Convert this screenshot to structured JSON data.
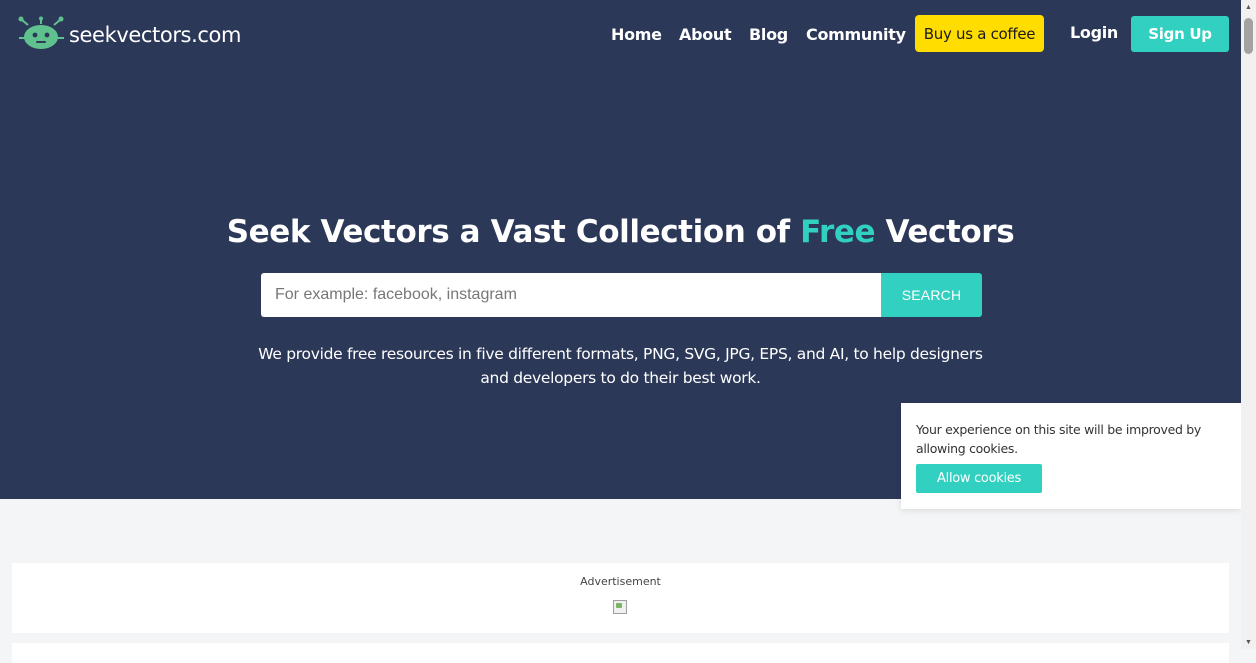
{
  "brand": {
    "logo_text": "seekvectors.com",
    "accent_color": "#31d0c0",
    "background_color": "#2c3858"
  },
  "nav": {
    "home": "Home",
    "about": "About",
    "blog": "Blog",
    "community": "Community",
    "coffee": "Buy us a coffee",
    "login": "Login",
    "signup": "Sign Up"
  },
  "hero": {
    "title_part1": "Seek Vectors a Vast Collection of ",
    "title_accent": "Free",
    "title_part2": " Vectors",
    "tagline": "We provide free resources in five different formats, PNG, SVG, JPG, EPS, and AI, to help designers and developers to do their best work."
  },
  "search": {
    "placeholder": "For example: facebook, instagram",
    "value": "",
    "button_label": "SEARCH"
  },
  "ad": {
    "label": "Advertisement"
  },
  "cookie": {
    "message": "Your experience on this site will be improved by allowing cookies.",
    "button_label": "Allow cookies"
  },
  "icons": {
    "logo": "robot-logo-icon",
    "broken_image": "broken-image-icon",
    "scroll_up": "scroll-up-arrow-icon",
    "scroll_down": "scroll-down-arrow-icon"
  }
}
